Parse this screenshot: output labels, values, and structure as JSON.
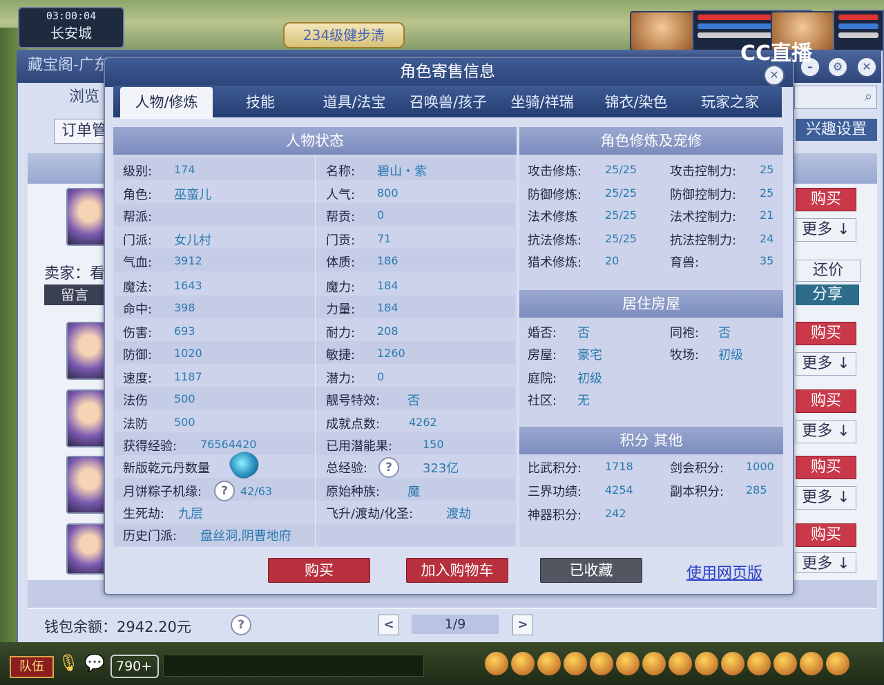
{
  "game": {
    "time": "03:00:04",
    "city": "长安城",
    "top_button": "234级健步清",
    "watermark": "CC直播",
    "bottom": {
      "team": "队伍",
      "count": "790+"
    }
  },
  "back_window": {
    "title": "藏宝阁-广东",
    "browse_tab": "浏览",
    "order_btn": "订单管",
    "interest_btn": "兴趣设置",
    "seller_label": "卖家：看",
    "msg_btn": "留言",
    "buy": "购买",
    "more": "更多 ↓",
    "bargain": "还价",
    "share": "分享",
    "wallet": "钱包余额：2942.20元",
    "help": "?",
    "page": "1/9",
    "prev": "<",
    "next": ">"
  },
  "modal": {
    "title": "角色寄售信息",
    "close": "✕",
    "tabs": [
      "人物/修炼",
      "技能",
      "道具/法宝",
      "召唤兽/孩子",
      "坐骑/祥瑞",
      "锦衣/染色",
      "玩家之家"
    ],
    "status_head": "人物状态",
    "cultivation_head": "角色修炼及宠修",
    "house_head": "居住房屋",
    "points_head": "积分 其他",
    "left_col": [
      {
        "label": "级别:",
        "value": "174"
      },
      {
        "label": "角色:",
        "value": "巫蛮儿"
      },
      {
        "label": "帮派:",
        "value": ""
      },
      {
        "label": "门派:",
        "value": "女儿村"
      },
      {
        "label": "气血:",
        "value": "3912"
      },
      {
        "label": "魔法:",
        "value": "1643"
      },
      {
        "label": "命中:",
        "value": "398"
      },
      {
        "label": "伤害:",
        "value": "693"
      },
      {
        "label": "防御:",
        "value": "1020"
      },
      {
        "label": "速度:",
        "value": "1187"
      },
      {
        "label": "法伤",
        "value": "500"
      },
      {
        "label": "法防",
        "value": "500"
      }
    ],
    "mid_col": [
      {
        "label": "名称:",
        "value": "碧山・紫"
      },
      {
        "label": "人气:",
        "value": "800"
      },
      {
        "label": "帮贡:",
        "value": "0"
      },
      {
        "label": "门贡:",
        "value": "71"
      },
      {
        "label": "体质:",
        "value": "186"
      },
      {
        "label": "魔力:",
        "value": "184"
      },
      {
        "label": "力量:",
        "value": "184"
      },
      {
        "label": "耐力:",
        "value": "208"
      },
      {
        "label": "敏捷:",
        "value": "1260"
      },
      {
        "label": "潜力:",
        "value": "0"
      },
      {
        "label": "靓号特效:",
        "value": "否"
      },
      {
        "label": "成就点数:",
        "value": "4262"
      }
    ],
    "extra_left": [
      {
        "label": "获得经验:",
        "value": "76564420"
      },
      {
        "label": "新版乾元丹数量",
        "value": ""
      },
      {
        "label": "月饼粽子机缘:",
        "value": "42/63"
      },
      {
        "label": "生死劫:",
        "value": "九层"
      },
      {
        "label": "历史门派:",
        "value": "盘丝洞,阴曹地府"
      }
    ],
    "extra_mid": [
      {
        "label": "已用潜能果:",
        "value": "150"
      },
      {
        "label": "总经验:",
        "value": "323亿"
      },
      {
        "label": "原始种族:",
        "value": "魔"
      },
      {
        "label": "飞升/渡劫/化圣:",
        "value": "渡劫"
      }
    ],
    "cultivation": [
      {
        "label": "攻击修炼:",
        "value": "25/25",
        "label2": "攻击控制力:",
        "value2": "25"
      },
      {
        "label": "防御修炼:",
        "value": "25/25",
        "label2": "防御控制力:",
        "value2": "25"
      },
      {
        "label": "法术修炼",
        "value": "25/25",
        "label2": "法术控制力:",
        "value2": "21"
      },
      {
        "label": "抗法修炼:",
        "value": "25/25",
        "label2": "抗法控制力:",
        "value2": "24"
      },
      {
        "label": "猎术修炼:",
        "value": "20",
        "label2": "育兽:",
        "value2": "35"
      }
    ],
    "house": [
      {
        "label": "婚否:",
        "value": "否",
        "label2": "同袍:",
        "value2": "否"
      },
      {
        "label": "房屋:",
        "value": "豪宅",
        "label2": "牧场:",
        "value2": "初级"
      },
      {
        "label": "庭院:",
        "value": "初级",
        "label2": "",
        "value2": ""
      },
      {
        "label": "社区:",
        "value": "无",
        "label2": "",
        "value2": ""
      }
    ],
    "points": [
      {
        "label": "比武积分:",
        "value": "1718",
        "label2": "剑会积分:",
        "value2": "1000"
      },
      {
        "label": "三界功绩:",
        "value": "4254",
        "label2": "副本积分:",
        "value2": "285"
      },
      {
        "label": "神器积分:",
        "value": "242",
        "label2": "",
        "value2": ""
      }
    ],
    "buttons": {
      "buy": "购买",
      "add_cart": "加入购物车",
      "collected": "已收藏",
      "web": "使用网页版"
    },
    "help": "?"
  },
  "colors": {
    "accent_red": "#b8303d",
    "tab_dark": "#2c467c",
    "value_blue": "#2a7ab0",
    "panel": "#cdd3ea"
  }
}
